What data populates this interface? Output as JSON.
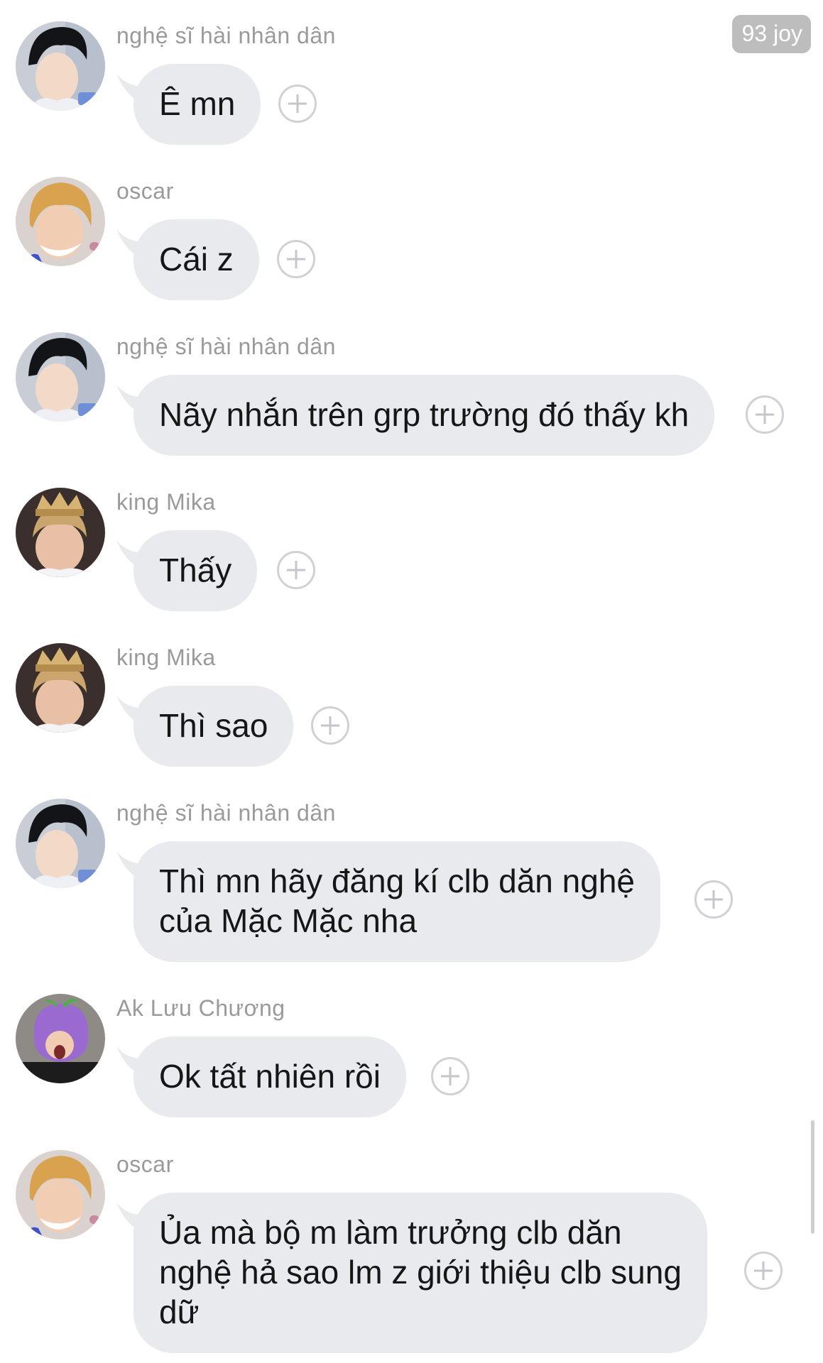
{
  "badge": {
    "text": "93 joy"
  },
  "colors": {
    "bubble": "#e9eaee",
    "sender_name": "#9a9a9a",
    "badge_bg": "#bdbdbd",
    "reaction_icon": "#c4c6cb"
  },
  "messages": [
    {
      "sender": "nghệ sĩ hài nhân dân",
      "avatar": "avatar-black-hair",
      "lines": [
        "Ê mn"
      ],
      "reaction_icon": "add-reaction-icon"
    },
    {
      "sender": "oscar",
      "avatar": "avatar-blonde-hair",
      "lines": [
        "Cái z"
      ],
      "reaction_icon": "add-reaction-icon"
    },
    {
      "sender": "nghệ sĩ hài nhân dân",
      "avatar": "avatar-black-hair",
      "lines": [
        "Nãy nhắn trên grp trường đó thấy kh"
      ],
      "reaction_icon": "add-reaction-icon"
    },
    {
      "sender": "king Mika",
      "avatar": "avatar-crown",
      "lines": [
        "Thấy"
      ],
      "reaction_icon": "add-reaction-icon"
    },
    {
      "sender": "king Mika",
      "avatar": "avatar-crown",
      "lines": [
        "Thì sao"
      ],
      "reaction_icon": "add-reaction-icon"
    },
    {
      "sender": "nghệ sĩ hài nhân dân",
      "avatar": "avatar-black-hair",
      "lines": [
        "Thì mn hãy đăng kí clb dăn nghệ",
        "của Mặc Mặc nha"
      ],
      "reaction_icon": "add-reaction-icon"
    },
    {
      "sender": "Ak Lưu Chương",
      "avatar": "avatar-purple-hat",
      "lines": [
        "Ok tất nhiên rồi"
      ],
      "reaction_icon": "add-reaction-icon"
    },
    {
      "sender": "oscar",
      "avatar": "avatar-blonde-hair",
      "lines": [
        "Ủa mà bộ m làm trưởng clb dăn",
        "nghệ hả sao lm z giới thiệu clb sung",
        "dữ"
      ],
      "reaction_icon": "add-reaction-icon"
    }
  ]
}
